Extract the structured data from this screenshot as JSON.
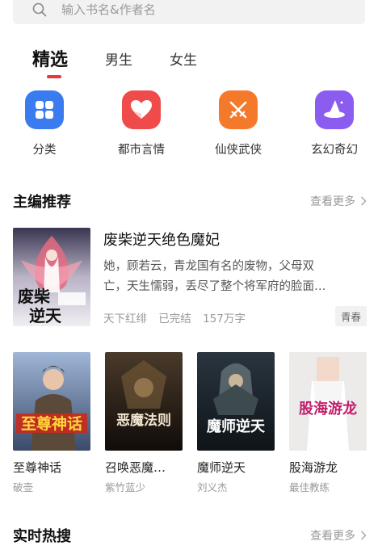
{
  "search": {
    "placeholder": "输入书名&作者名"
  },
  "tabs": [
    {
      "label": "精选",
      "active": true
    },
    {
      "label": "男生"
    },
    {
      "label": "女生"
    }
  ],
  "categories": [
    {
      "label": "分类",
      "icon": "grid-icon",
      "color": "#3b7bf0"
    },
    {
      "label": "都市言情",
      "icon": "heart-icon",
      "color": "#ef4b4b"
    },
    {
      "label": "仙侠武侠",
      "icon": "swords-icon",
      "color": "#f5792a"
    },
    {
      "label": "玄幻奇幻",
      "icon": "wizard-hat-icon",
      "color": "#8b5cf0"
    }
  ],
  "editor_picks": {
    "title": "主编推荐",
    "more": "查看更多",
    "featured": {
      "title": "废柴逆天绝色魔妃",
      "desc_line1": "她，顾若云，青龙国有名的废物，父母双",
      "desc_line2": "亡，天生懦弱，丢尽了整个将军府的脸面…",
      "author": "天下红绯",
      "status": "已完结",
      "words": "157万字",
      "tag": "青春",
      "cover_text": "废柴逆天"
    },
    "books": [
      {
        "title": "至尊神话",
        "author": "破壶",
        "cover_text": "至尊神话"
      },
      {
        "title": "召唤恶魔…",
        "author": "紫竹蓝少",
        "cover_text": "恶魔法则"
      },
      {
        "title": "魔师逆天",
        "author": "刘义杰",
        "cover_text": "魔师逆天"
      },
      {
        "title": "股海游龙",
        "author": "最佳教练",
        "cover_text": "股海游龙"
      }
    ]
  },
  "hot_search": {
    "title": "实时热搜",
    "more": "查看更多"
  }
}
